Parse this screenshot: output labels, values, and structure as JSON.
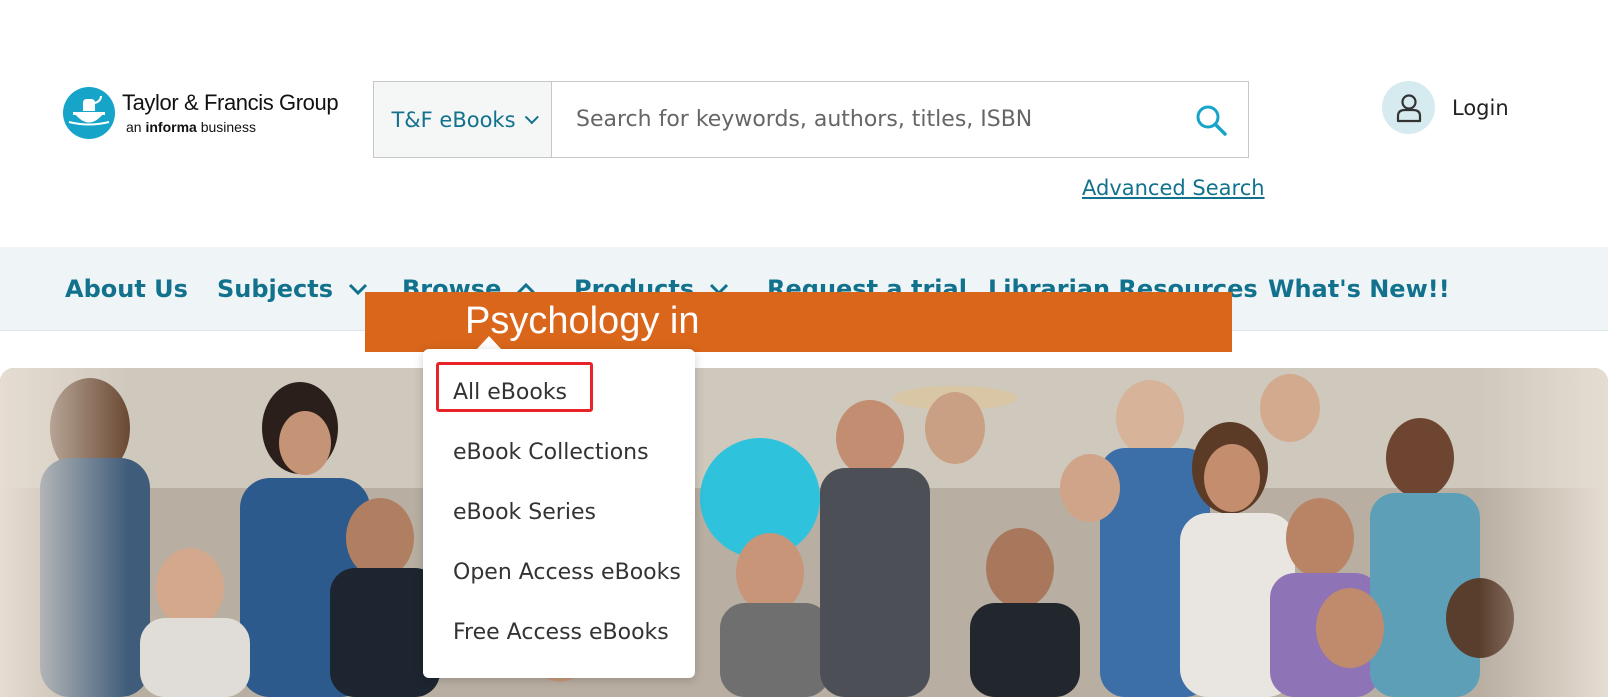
{
  "brand": {
    "name": "Taylor & Francis Group",
    "tagline_prefix": "an",
    "tagline_bold": "informa",
    "tagline_suffix": "business",
    "color": "#16a4c9"
  },
  "search": {
    "scope_label": "T&F eBooks",
    "placeholder": "Search for keywords, authors, titles, ISBN",
    "value": "",
    "advanced_label": "Advanced Search"
  },
  "account": {
    "login_label": "Login"
  },
  "nav": {
    "items": [
      {
        "label": "About Us"
      },
      {
        "label": "Subjects"
      },
      {
        "label": "Browse"
      },
      {
        "label": "Products"
      },
      {
        "label": "Request a trial"
      },
      {
        "label": "Librarian Resources"
      },
      {
        "label": "What's New!!"
      }
    ]
  },
  "browse_menu": {
    "items": [
      {
        "label": "All eBooks"
      },
      {
        "label": "eBook Collections"
      },
      {
        "label": "eBook Series"
      },
      {
        "label": "Open Access eBooks"
      },
      {
        "label": "Free Access eBooks"
      }
    ]
  },
  "hero": {
    "book_title": "Psychology in"
  },
  "colors": {
    "accent": "#12728e",
    "nav_bg": "#eff5f6",
    "highlight": "#e8232a",
    "banner": "#d9661b"
  }
}
